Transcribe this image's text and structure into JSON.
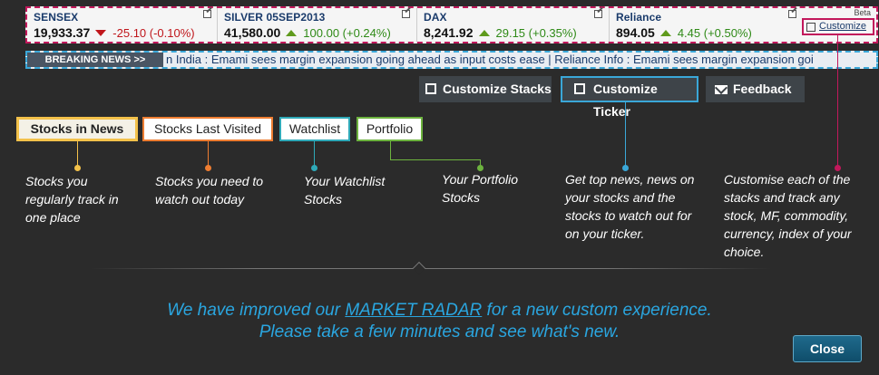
{
  "ticker": {
    "items": [
      {
        "name": "SENSEX",
        "value": "19,933.37",
        "change": "-25.10 (-0.10%)",
        "direction": "down"
      },
      {
        "name": "SILVER 05SEP2013",
        "value": "41,580.00",
        "change": "100.00 (+0.24%)",
        "direction": "up"
      },
      {
        "name": "DAX",
        "value": "8,241.92",
        "change": "29.15 (+0.35%)",
        "direction": "up"
      },
      {
        "name": "Reliance",
        "value": "894.05",
        "change": "4.45 (+0.50%)",
        "direction": "up"
      }
    ],
    "beta_label": "Beta",
    "customize_label": "Customize"
  },
  "breaking": {
    "label": "BREAKING NEWS >>",
    "text": "n India : Emami sees margin expansion going ahead as input costs ease  |  Reliance Info :  Emami sees margin expansion goi"
  },
  "buttons": {
    "customize_stacks": "Customize Stacks",
    "customize_ticker": "Customize Ticker",
    "feedback": "Feedback",
    "close": "Close"
  },
  "tabs": {
    "stocks_in_news": "Stocks in News",
    "stocks_last_visited": "Stocks Last Visited",
    "watchlist": "Watchlist",
    "portfolio": "Portfolio"
  },
  "descriptions": {
    "news": "Stocks you regularly track in one place",
    "last_visited": "Stocks you need to watch out today",
    "watchlist": "Your Watchlist Stocks",
    "portfolio": "Your Portfolio Stocks",
    "ticker": "Get top news, news on your stocks and the stocks to watch out for on your ticker.",
    "customize": "Customise each of the stacks and track any stock, MF, commodity, currency, index of your choice."
  },
  "message": {
    "pre": "We have improved our ",
    "link": "MARKET RADAR",
    "post": " for a new custom experience.",
    "line2": "Please take a few minutes and see what's new."
  },
  "colors": {
    "background": "#2b2b2b",
    "accent_blue": "#2aa6e0",
    "news": "#f3c14a",
    "last_visited": "#ee7d31",
    "watchlist": "#2fa9b8",
    "portfolio": "#6db33f",
    "customize": "#c2185b"
  }
}
